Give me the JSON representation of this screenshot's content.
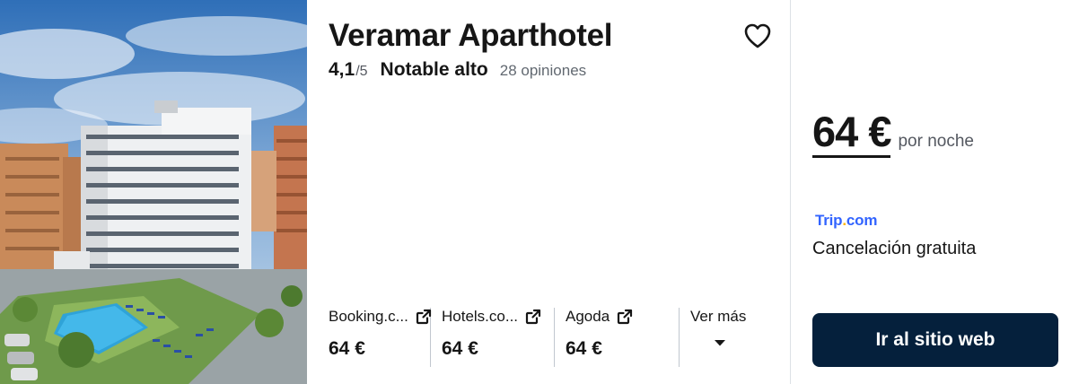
{
  "hotel": {
    "name": "Veramar Aparthotel",
    "score": "4,1",
    "score_max": "/5",
    "rating_label": "Notable alto",
    "reviews": "28 opiniones"
  },
  "providers": [
    {
      "name": "Booking.c...",
      "price": "64 €"
    },
    {
      "name": "Hotels.co...",
      "price": "64 €"
    },
    {
      "name": "Agoda",
      "price": "64 €"
    }
  ],
  "more_label": "Ver más",
  "offer": {
    "price": "64 €",
    "per_night": "por noche",
    "provider_logo_main": "Trip",
    "provider_logo_dot": ".",
    "provider_logo_tail": "com",
    "cancellation": "Cancelación gratuita",
    "cta_label": "Ir al sitio web"
  },
  "colors": {
    "cta_background": "#05203c",
    "provider_logo": "#3264ff",
    "divider": "#c1c7cf"
  },
  "icons": {
    "favorite": "heart-icon",
    "external": "external-link-icon",
    "expand": "caret-down-icon"
  }
}
